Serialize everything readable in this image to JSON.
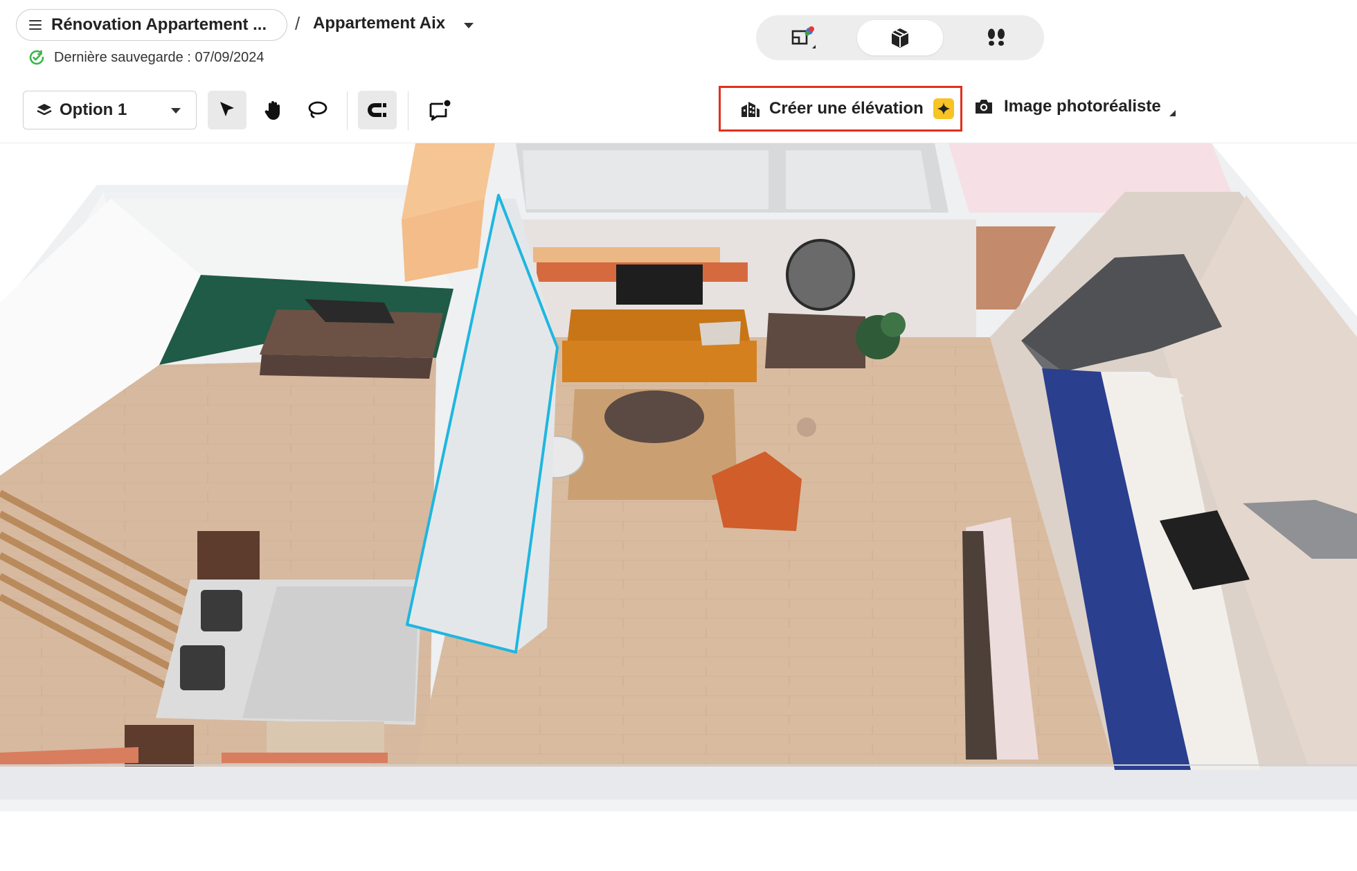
{
  "header": {
    "project_title": "Rénovation Appartement ...",
    "separator": "/",
    "apartment_name": "Appartement Aix",
    "save_status": "Dernière sauvegarde : 07/09/2024"
  },
  "view_modes": {
    "items": [
      "plan-2d-view",
      "3d-view",
      "walk-view"
    ],
    "active": "3d-view"
  },
  "toolbar": {
    "option_label": "Option 1",
    "create_elevation_label": "Créer une élévation",
    "photorealistic_label": "Image photoréaliste",
    "active_tool": "select-tool"
  },
  "colors": {
    "accent_highlight": "#e0301e",
    "selection_outline": "#1fb6e0",
    "ai_badge": "#f7c325",
    "saved_icon": "#3cb54a"
  }
}
